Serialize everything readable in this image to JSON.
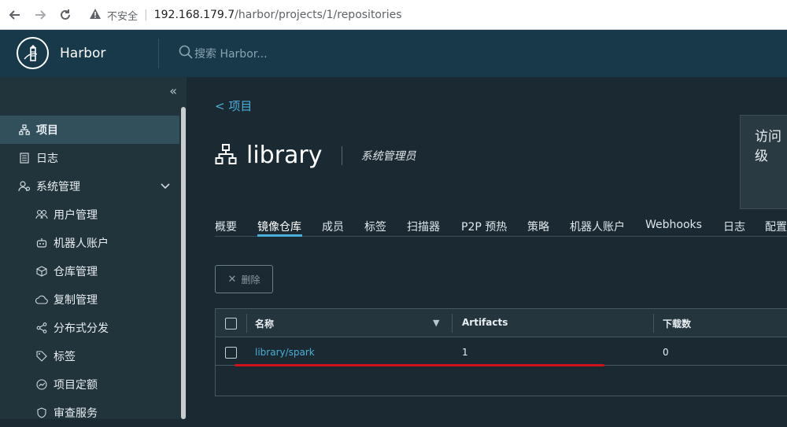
{
  "browser": {
    "security_label": "不安全",
    "url_host": "192.168.179.7",
    "url_path": "/harbor/projects/1/repositories"
  },
  "header": {
    "brand": "Harbor",
    "search_placeholder": "搜索 Harbor..."
  },
  "sidebar": {
    "items": [
      {
        "label": "项目",
        "icon": "projects-icon",
        "active": true
      },
      {
        "label": "日志",
        "icon": "logs-icon"
      },
      {
        "label": "系统管理",
        "icon": "admin-icon"
      },
      {
        "label": "用户管理",
        "icon": "users-icon"
      },
      {
        "label": "机器人账户",
        "icon": "robot-icon"
      },
      {
        "label": "仓库管理",
        "icon": "registry-icon"
      },
      {
        "label": "复制管理",
        "icon": "replication-icon"
      },
      {
        "label": "分布式分发",
        "icon": "share-icon"
      },
      {
        "label": "标签",
        "icon": "tag-icon"
      },
      {
        "label": "项目定额",
        "icon": "quota-icon"
      },
      {
        "label": "审查服务",
        "icon": "shield-icon"
      }
    ]
  },
  "main": {
    "back_label": "< 项目",
    "title": "library",
    "role": "系统管理员",
    "popup_text": "访问级",
    "tabs": [
      "概要",
      "镜像仓库",
      "成员",
      "标签",
      "扫描器",
      "P2P 预热",
      "策略",
      "机器人账户",
      "Webhooks",
      "日志",
      "配置"
    ],
    "active_tab": "镜像仓库",
    "delete_label": "删除",
    "grid": {
      "columns": [
        "名称",
        "Artifacts",
        "下载数"
      ],
      "rows": [
        {
          "name": "library/spark",
          "artifacts": "1",
          "downloads": "0"
        }
      ]
    }
  },
  "colors": {
    "header_bg": "#17394a",
    "sidebar_bg": "#21333b",
    "main_bg": "#1b2a32",
    "accent": "#4aaed9",
    "annotation": "#d0131a"
  }
}
